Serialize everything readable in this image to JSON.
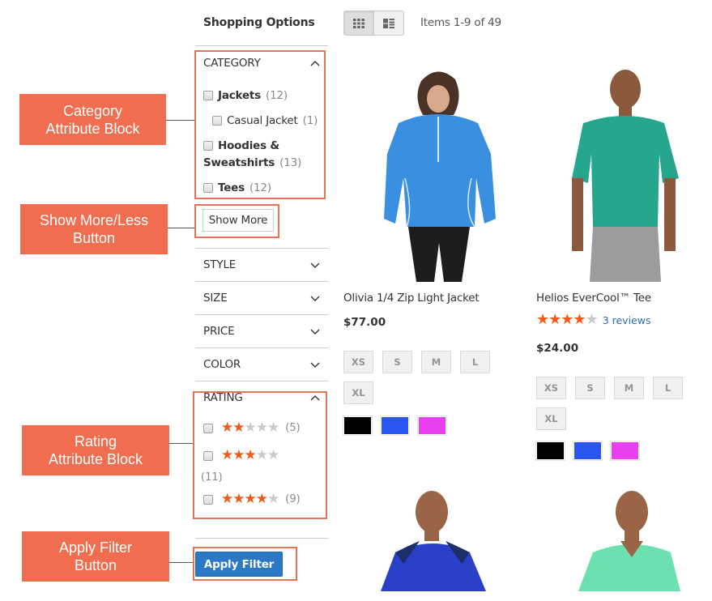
{
  "sidebar": {
    "title": "Shopping Options",
    "category": {
      "label": "CATEGORY",
      "items": [
        {
          "name": "Jackets",
          "count": "(12)",
          "level": 0
        },
        {
          "name": "Casual Jacket",
          "count": "(1)",
          "level": 1
        },
        {
          "name": "Hoodies &",
          "name2": "Sweatshirts",
          "count": "(13)",
          "level": 0
        },
        {
          "name": "Tees",
          "count": "(12)",
          "level": 0
        }
      ]
    },
    "show_more_label": "Show More",
    "filters": [
      {
        "label": "STYLE"
      },
      {
        "label": "SIZE"
      },
      {
        "label": "PRICE"
      },
      {
        "label": "COLOR"
      }
    ],
    "rating": {
      "label": "RATING",
      "options": [
        {
          "stars": 2,
          "of": 5,
          "count": "(5)"
        },
        {
          "stars": 3,
          "of": 5,
          "count": "(11)"
        },
        {
          "stars": 4,
          "of": 5,
          "count": "(9)"
        }
      ]
    },
    "apply_label": "Apply Filter"
  },
  "callouts": {
    "category": [
      "Category",
      "Attribute Block"
    ],
    "show_more": [
      "Show More/Less",
      "Button"
    ],
    "rating": [
      "Rating",
      "Attribute Block"
    ],
    "apply": [
      "Apply Filter",
      "Button"
    ]
  },
  "toolbar": {
    "view_modes": [
      {
        "name": "grid",
        "active": true
      },
      {
        "name": "list",
        "active": false
      }
    ],
    "items_count": "Items 1-9 of 49"
  },
  "products": [
    {
      "name": "Olivia 1/4 Zip Light Jacket",
      "price": "$77.00",
      "rating": null,
      "reviews": null,
      "sizes": [
        "XS",
        "S",
        "M",
        "L",
        "XL"
      ],
      "colors": [
        "#000000",
        "#2a55f0",
        "#ea3ff0"
      ],
      "image": "woman in blue quarter-zip jacket"
    },
    {
      "name": "Helios EverCool™ Tee",
      "price": "$24.00",
      "rating": 4,
      "rating_of": 5,
      "reviews": "3 reviews",
      "sizes": [
        "XS",
        "S",
        "M",
        "L",
        "XL"
      ],
      "colors": [
        "#000000",
        "#2a55f0",
        "#ea3ff0"
      ],
      "image": "man in teal t-shirt"
    },
    {
      "name": "",
      "image": "man in blue t-shirt"
    },
    {
      "name": "",
      "image": "man in mint v-neck t-shirt"
    }
  ],
  "colors": {
    "callout": "#f06d4f",
    "highlight": "#e3735a",
    "primary_button": "#2a78c6",
    "star_on": "#f05a1a",
    "star_off": "#c9c9c9",
    "link": "#2a6cb5"
  }
}
